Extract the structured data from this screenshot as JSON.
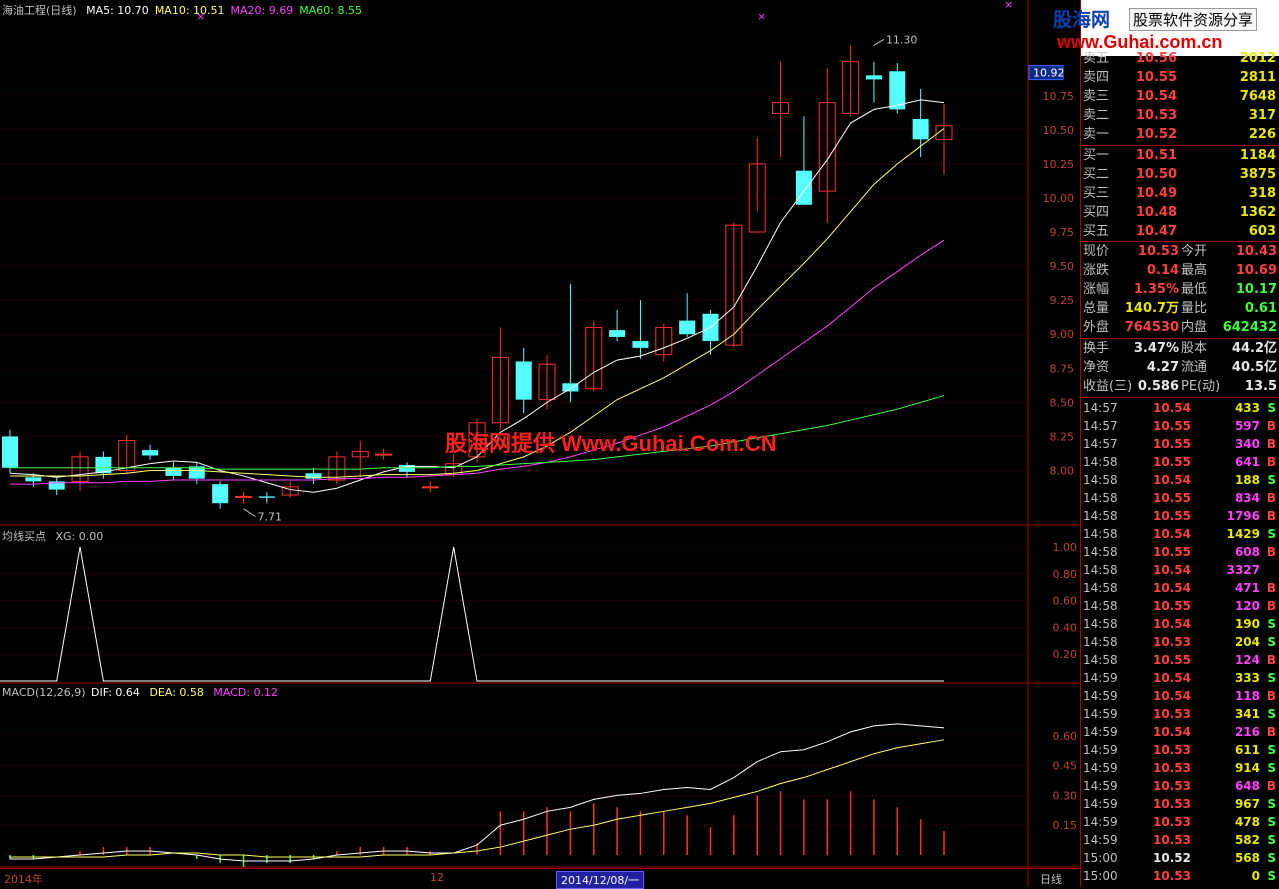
{
  "title": "海油工程(日线)",
  "ma_legend": [
    {
      "label": "MA5: 10.70",
      "color": "#ffffff"
    },
    {
      "label": "MA10: 10.51",
      "color": "#ffff66"
    },
    {
      "label": "MA20: 9.69",
      "color": "#ff40ff"
    },
    {
      "label": "MA60: 8.55",
      "color": "#40ff40"
    }
  ],
  "indicator_legend": {
    "name": "均线买点",
    "xg": "XG: 0.00"
  },
  "macd_legend": {
    "name": "MACD(12,26,9)",
    "dif": "DIF: 0.64",
    "dea": "DEA: 0.58",
    "macd": "MACD: 0.12"
  },
  "price_axis": [
    "10.75",
    "10.50",
    "10.25",
    "10.00",
    "9.75",
    "9.50",
    "9.25",
    "9.00",
    "8.75",
    "8.50",
    "8.25",
    "8.00"
  ],
  "price_highlight": "10.92",
  "indicator_axis": [
    "1.00",
    "0.80",
    "0.60",
    "0.40",
    "0.20"
  ],
  "macd_axis": [
    "0.60",
    "0.45",
    "0.30",
    "0.15"
  ],
  "annotations": {
    "high": "11.30",
    "low": "7.71"
  },
  "watermark": "股海网提供 Www.Guhai.Com.CN",
  "bottom": {
    "year": "2014年",
    "month": "12",
    "date": "2014/12/08/一",
    "period": "日线"
  },
  "banner": {
    "logo": "股海网",
    "tag": "股票软件资源分享",
    "url": "www.Guhai.com.cn"
  },
  "order_book": {
    "sell": [
      {
        "label": "卖五",
        "price": "10.56",
        "vol": "2012"
      },
      {
        "label": "卖四",
        "price": "10.55",
        "vol": "2811"
      },
      {
        "label": "卖三",
        "price": "10.54",
        "vol": "7648"
      },
      {
        "label": "卖二",
        "price": "10.53",
        "vol": "317"
      },
      {
        "label": "卖一",
        "price": "10.52",
        "vol": "226"
      }
    ],
    "buy": [
      {
        "label": "买一",
        "price": "10.51",
        "vol": "1184"
      },
      {
        "label": "买二",
        "price": "10.50",
        "vol": "3875"
      },
      {
        "label": "买三",
        "price": "10.49",
        "vol": "318"
      },
      {
        "label": "买四",
        "price": "10.48",
        "vol": "1362"
      },
      {
        "label": "买五",
        "price": "10.47",
        "vol": "603"
      }
    ]
  },
  "quote": [
    {
      "l1": "现价",
      "v1": "10.53",
      "c1": "#ff4040",
      "l2": "今开",
      "v2": "10.43",
      "c2": "#ff4040"
    },
    {
      "l1": "涨跌",
      "v1": "0.14",
      "c1": "#ff4040",
      "l2": "最高",
      "v2": "10.69",
      "c2": "#ff4040"
    },
    {
      "l1": "涨幅",
      "v1": "1.35%",
      "c1": "#ff4040",
      "l2": "最低",
      "v2": "10.17",
      "c2": "#40ff40"
    },
    {
      "l1": "总量",
      "v1": "140.7万",
      "c1": "#e8e800",
      "l2": "量比",
      "v2": "0.61",
      "c2": "#40ff40"
    },
    {
      "l1": "外盘",
      "v1": "764530",
      "c1": "#ff4040",
      "l2": "内盘",
      "v2": "642432",
      "c2": "#40ff40"
    }
  ],
  "stats": [
    {
      "l1": "换手",
      "v1": "3.47%",
      "l2": "股本",
      "v2": "44.2亿"
    },
    {
      "l1": "净资",
      "v1": "4.27",
      "l2": "流通",
      "v2": "40.5亿"
    },
    {
      "l1": "收益(三)",
      "v1": "0.586",
      "l2": "PE(动)",
      "v2": "13.5"
    }
  ],
  "ticks": [
    {
      "t": "14:57",
      "p": "10.54",
      "v": "433",
      "d": "S"
    },
    {
      "t": "14:57",
      "p": "10.55",
      "v": "597",
      "d": "B"
    },
    {
      "t": "14:57",
      "p": "10.55",
      "v": "340",
      "d": "B"
    },
    {
      "t": "14:58",
      "p": "10.55",
      "v": "641",
      "d": "B"
    },
    {
      "t": "14:58",
      "p": "10.54",
      "v": "188",
      "d": "S"
    },
    {
      "t": "14:58",
      "p": "10.55",
      "v": "834",
      "d": "B"
    },
    {
      "t": "14:58",
      "p": "10.55",
      "v": "1796",
      "d": "B"
    },
    {
      "t": "14:58",
      "p": "10.54",
      "v": "1429",
      "d": "S"
    },
    {
      "t": "14:58",
      "p": "10.55",
      "v": "608",
      "d": "B"
    },
    {
      "t": "14:58",
      "p": "10.54",
      "v": "3327",
      "d": ""
    },
    {
      "t": "14:58",
      "p": "10.54",
      "v": "471",
      "d": "B"
    },
    {
      "t": "14:58",
      "p": "10.55",
      "v": "120",
      "d": "B"
    },
    {
      "t": "14:58",
      "p": "10.54",
      "v": "190",
      "d": "S"
    },
    {
      "t": "14:58",
      "p": "10.53",
      "v": "204",
      "d": "S"
    },
    {
      "t": "14:58",
      "p": "10.55",
      "v": "124",
      "d": "B"
    },
    {
      "t": "14:59",
      "p": "10.54",
      "v": "333",
      "d": "S"
    },
    {
      "t": "14:59",
      "p": "10.54",
      "v": "118",
      "d": "B"
    },
    {
      "t": "14:59",
      "p": "10.53",
      "v": "341",
      "d": "S"
    },
    {
      "t": "14:59",
      "p": "10.54",
      "v": "216",
      "d": "B"
    },
    {
      "t": "14:59",
      "p": "10.53",
      "v": "611",
      "d": "S"
    },
    {
      "t": "14:59",
      "p": "10.53",
      "v": "914",
      "d": "S"
    },
    {
      "t": "14:59",
      "p": "10.53",
      "v": "648",
      "d": "B"
    },
    {
      "t": "14:59",
      "p": "10.53",
      "v": "967",
      "d": "S"
    },
    {
      "t": "14:59",
      "p": "10.53",
      "v": "478",
      "d": "S"
    },
    {
      "t": "14:59",
      "p": "10.53",
      "v": "582",
      "d": "S"
    },
    {
      "t": "15:00",
      "p": "10.52",
      "v": "568",
      "d": "S"
    },
    {
      "t": "15:00",
      "p": "10.53",
      "v": "0",
      "d": "S"
    }
  ],
  "chart_data": {
    "type": "candlestick",
    "candles": [
      [
        8.25,
        8.02,
        8.3,
        7.98
      ],
      [
        7.95,
        7.92,
        7.98,
        7.88
      ],
      [
        7.92,
        7.86,
        7.95,
        7.82
      ],
      [
        7.92,
        8.1,
        8.14,
        7.85
      ],
      [
        8.1,
        7.98,
        8.14,
        7.94
      ],
      [
        8.0,
        8.22,
        8.26,
        7.98
      ],
      [
        8.15,
        8.11,
        8.19,
        8.08
      ],
      [
        8.02,
        7.96,
        8.06,
        7.93
      ],
      [
        8.03,
        7.94,
        8.06,
        7.9
      ],
      [
        7.9,
        7.76,
        7.92,
        7.72
      ],
      [
        7.81,
        7.81,
        7.84,
        7.76
      ],
      [
        7.81,
        7.8,
        7.84,
        7.76
      ],
      [
        7.82,
        7.88,
        7.92,
        7.8
      ],
      [
        7.98,
        7.94,
        8.02,
        7.9
      ],
      [
        7.93,
        8.1,
        8.14,
        7.9
      ],
      [
        8.1,
        8.14,
        8.22,
        7.95
      ],
      [
        8.12,
        8.12,
        8.16,
        8.08
      ],
      [
        8.04,
        7.99,
        8.06,
        7.95
      ],
      [
        7.88,
        7.88,
        7.92,
        7.84
      ],
      [
        7.97,
        8.05,
        8.12,
        7.95
      ],
      [
        8.1,
        8.35,
        8.38,
        8.06
      ],
      [
        8.35,
        8.83,
        9.05,
        8.3
      ],
      [
        8.8,
        8.52,
        8.9,
        8.42
      ],
      [
        8.52,
        8.78,
        8.85,
        8.45
      ],
      [
        8.64,
        8.58,
        9.37,
        8.5
      ],
      [
        8.6,
        9.05,
        9.1,
        8.58
      ],
      [
        9.03,
        8.98,
        9.18,
        8.95
      ],
      [
        8.95,
        8.9,
        9.25,
        8.82
      ],
      [
        8.85,
        9.05,
        9.08,
        8.8
      ],
      [
        9.1,
        9.0,
        9.3,
        8.98
      ],
      [
        9.15,
        8.95,
        9.18,
        8.85
      ],
      [
        8.92,
        9.8,
        9.82,
        8.9
      ],
      [
        9.75,
        10.25,
        10.45,
        9.9
      ],
      [
        10.62,
        10.7,
        11.0,
        10.3
      ],
      [
        10.2,
        9.95,
        10.6,
        9.95
      ],
      [
        10.05,
        10.7,
        10.95,
        9.82
      ],
      [
        10.62,
        11.0,
        11.12,
        10.6
      ],
      [
        10.9,
        10.87,
        11.0,
        10.7
      ],
      [
        10.93,
        10.65,
        10.99,
        10.62
      ],
      [
        10.58,
        10.43,
        10.8,
        10.3
      ],
      [
        10.43,
        10.53,
        10.69,
        10.17
      ]
    ],
    "ma": {
      "MA5": [
        7.98,
        7.97,
        7.95,
        7.97,
        7.99,
        8.02,
        8.05,
        8.07,
        8.06,
        8.0,
        7.96,
        7.91,
        7.86,
        7.84,
        7.87,
        7.93,
        7.99,
        8.03,
        8.03,
        8.02,
        8.1,
        8.28,
        8.38,
        8.5,
        8.6,
        8.72,
        8.81,
        8.84,
        8.9,
        8.97,
        9.05,
        9.2,
        9.5,
        9.82,
        10.05,
        10.28,
        10.55,
        10.65,
        10.68,
        10.72,
        10.7
      ],
      "MA10": [
        7.96,
        7.96,
        7.96,
        7.96,
        7.97,
        7.98,
        8.0,
        8.0,
        8.0,
        7.99,
        7.98,
        7.97,
        7.96,
        7.95,
        7.95,
        7.96,
        7.97,
        7.97,
        7.97,
        7.98,
        8.0,
        8.05,
        8.1,
        8.18,
        8.28,
        8.4,
        8.52,
        8.6,
        8.68,
        8.78,
        8.88,
        9.0,
        9.18,
        9.35,
        9.52,
        9.7,
        9.9,
        10.1,
        10.25,
        10.38,
        10.51
      ],
      "MA20": [
        7.9,
        7.9,
        7.91,
        7.91,
        7.91,
        7.92,
        7.92,
        7.93,
        7.93,
        7.93,
        7.93,
        7.93,
        7.93,
        7.93,
        7.94,
        7.94,
        7.95,
        7.95,
        7.96,
        7.97,
        7.98,
        8.01,
        8.03,
        8.06,
        8.1,
        8.15,
        8.2,
        8.26,
        8.32,
        8.4,
        8.48,
        8.58,
        8.7,
        8.82,
        8.94,
        9.06,
        9.2,
        9.34,
        9.46,
        9.58,
        9.69
      ],
      "MA60": [
        8.02,
        8.02,
        8.02,
        8.02,
        8.02,
        8.02,
        8.02,
        8.02,
        8.02,
        8.01,
        8.01,
        8.01,
        8.01,
        8.01,
        8.01,
        8.01,
        8.02,
        8.02,
        8.02,
        8.03,
        8.03,
        8.04,
        8.05,
        8.06,
        8.07,
        8.08,
        8.1,
        8.12,
        8.14,
        8.16,
        8.18,
        8.21,
        8.24,
        8.27,
        8.3,
        8.33,
        8.37,
        8.41,
        8.45,
        8.5,
        8.55
      ]
    },
    "xg": [
      0,
      0,
      0,
      1,
      0,
      0,
      0,
      0,
      0,
      0,
      0,
      0,
      0,
      0,
      0,
      0,
      0,
      0,
      0,
      1,
      0,
      0,
      0,
      0,
      0,
      0,
      0,
      0,
      0,
      0,
      0,
      0,
      0,
      0,
      0,
      0,
      0,
      0,
      0,
      0,
      0
    ],
    "dif": [
      -0.02,
      -0.02,
      -0.01,
      0.0,
      0.01,
      0.02,
      0.02,
      0.01,
      0.0,
      -0.02,
      -0.03,
      -0.03,
      -0.03,
      -0.02,
      0.0,
      0.01,
      0.02,
      0.02,
      0.01,
      0.01,
      0.05,
      0.15,
      0.18,
      0.22,
      0.24,
      0.28,
      0.3,
      0.31,
      0.33,
      0.34,
      0.33,
      0.39,
      0.47,
      0.52,
      0.53,
      0.57,
      0.62,
      0.65,
      0.66,
      0.65,
      0.64
    ],
    "dea": [
      -0.01,
      -0.01,
      -0.01,
      -0.01,
      -0.01,
      0.0,
      0.0,
      0.01,
      0.01,
      0.0,
      0.0,
      -0.01,
      -0.01,
      -0.01,
      -0.01,
      -0.01,
      0.0,
      0.0,
      0.0,
      0.01,
      0.02,
      0.04,
      0.07,
      0.1,
      0.13,
      0.15,
      0.18,
      0.2,
      0.22,
      0.24,
      0.26,
      0.29,
      0.32,
      0.36,
      0.39,
      0.43,
      0.47,
      0.51,
      0.54,
      0.56,
      0.58
    ],
    "macd": [
      -0.02,
      -0.02,
      0.0,
      0.02,
      0.04,
      0.04,
      0.04,
      0.0,
      -0.02,
      -0.04,
      -0.06,
      -0.04,
      -0.04,
      -0.02,
      0.02,
      0.04,
      0.04,
      0.04,
      0.02,
      0.0,
      0.06,
      0.22,
      0.22,
      0.24,
      0.22,
      0.26,
      0.24,
      0.22,
      0.22,
      0.2,
      0.14,
      0.2,
      0.3,
      0.32,
      0.28,
      0.28,
      0.32,
      0.28,
      0.24,
      0.18,
      0.12
    ],
    "price_range": [
      7.6,
      11.35
    ],
    "macd_range": [
      -0.05,
      0.72
    ]
  }
}
